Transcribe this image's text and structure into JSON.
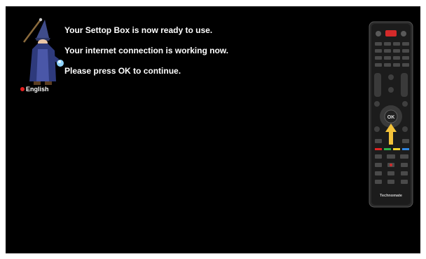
{
  "messages": {
    "line1": "Your Settop Box is now ready to use.",
    "line2": "Your internet connection is working now.",
    "line3": "Please press OK to continue."
  },
  "language": {
    "label": "English",
    "indicator_color": "#e52020"
  },
  "remote": {
    "ok_label": "OK",
    "brand": "Technomate",
    "arrow_color": "#f3c23a",
    "color_keys": [
      "#e02424",
      "#2fb34a",
      "#f3d22a",
      "#2f86e0"
    ]
  }
}
